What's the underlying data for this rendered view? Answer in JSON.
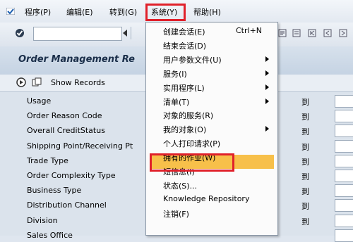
{
  "menubar": {
    "items": [
      "程序(P)",
      "编辑(E)",
      "转到(G)",
      "系统(Y)",
      "帮助(H)"
    ]
  },
  "page": {
    "title": "Order Management Re"
  },
  "app_toolbar": {
    "show_records": "Show Records"
  },
  "form": {
    "rows": [
      {
        "label": "Usage",
        "to": "到"
      },
      {
        "label": "Order Reason Code",
        "to": "到"
      },
      {
        "label": "Overall CreditStatus",
        "to": "到"
      },
      {
        "label": "Shipping Point/Receiving Pt",
        "to": "到"
      },
      {
        "label": "Trade Type",
        "to": "到"
      },
      {
        "label": "Order Complexity Type",
        "to": "到"
      },
      {
        "label": "Business Type",
        "to": "到"
      },
      {
        "label": "Distribution Channel",
        "to": "到"
      },
      {
        "label": "Division",
        "to": "到"
      },
      {
        "label": "Sales Office",
        "to": ""
      }
    ]
  },
  "dropdown": {
    "items": [
      {
        "label": "创建会话(E)",
        "shortcut": "Ctrl+N",
        "submenu": false
      },
      {
        "label": "结束会话(D)",
        "shortcut": "",
        "submenu": false
      },
      {
        "label": "用户参数文件(U)",
        "shortcut": "",
        "submenu": true
      },
      {
        "label": "服务(I)",
        "shortcut": "",
        "submenu": true
      },
      {
        "label": "实用程序(L)",
        "shortcut": "",
        "submenu": true
      },
      {
        "label": "清单(T)",
        "shortcut": "",
        "submenu": true
      },
      {
        "label": "对象的服务(R)",
        "shortcut": "",
        "submenu": false
      },
      {
        "label": "我的对象(O)",
        "shortcut": "",
        "submenu": true
      },
      {
        "label": "个人打印请求(P)",
        "shortcut": "",
        "submenu": false
      },
      {
        "label": "拥有的作业(W)",
        "shortcut": "",
        "submenu": false
      },
      {
        "label": "短信息(I)",
        "shortcut": "",
        "submenu": false
      },
      {
        "label": "状态(S)...",
        "shortcut": "",
        "submenu": false
      },
      {
        "label": "Knowledge Repository",
        "shortcut": "",
        "submenu": false
      },
      {
        "label": "注销(F)",
        "shortcut": "",
        "submenu": false
      }
    ]
  },
  "colors": {
    "highlight_red": "#e0202a",
    "selected_item": "#f7c04a",
    "title_text": "#1b2f4a"
  }
}
